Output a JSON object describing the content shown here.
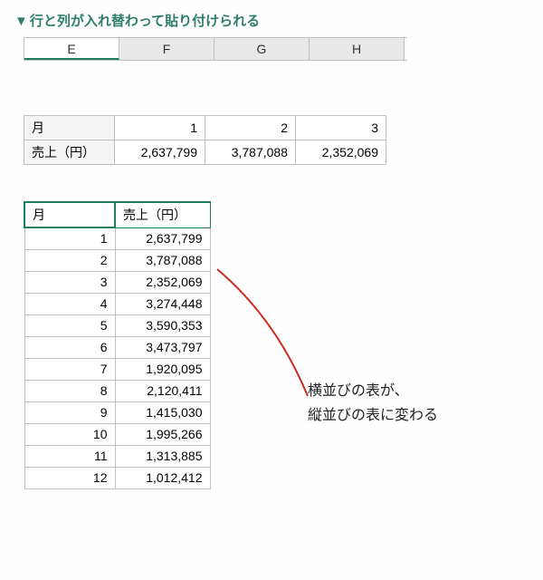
{
  "heading": {
    "marker": "▼",
    "text": "行と列が入れ替わって貼り付けられる"
  },
  "column_headers": [
    "E",
    "F",
    "G",
    "H"
  ],
  "selected_column_index": 0,
  "horizontal_table": {
    "row_labels": [
      "月",
      "売上（円）"
    ],
    "months": [
      1,
      2,
      3
    ],
    "values": [
      "2,637,799",
      "3,787,088",
      "2,352,069"
    ]
  },
  "vertical_table": {
    "headers": [
      "月",
      "売上（円）"
    ],
    "rows": [
      {
        "m": 1,
        "v": "2,637,799"
      },
      {
        "m": 2,
        "v": "3,787,088"
      },
      {
        "m": 3,
        "v": "2,352,069"
      },
      {
        "m": 4,
        "v": "3,274,448"
      },
      {
        "m": 5,
        "v": "3,590,353"
      },
      {
        "m": 6,
        "v": "3,473,797"
      },
      {
        "m": 7,
        "v": "1,920,095"
      },
      {
        "m": 8,
        "v": "2,120,411"
      },
      {
        "m": 9,
        "v": "1,415,030"
      },
      {
        "m": 10,
        "v": "1,995,266"
      },
      {
        "m": 11,
        "v": "1,313,885"
      },
      {
        "m": 12,
        "v": "1,012,412"
      }
    ]
  },
  "annotation": {
    "line1": "横並びの表が、",
    "line2": "縦並びの表に変わる"
  },
  "colors": {
    "accent_green": "#1a7f5a",
    "heading_green": "#2e7d6b",
    "arrow_red": "#cc2b1f"
  }
}
